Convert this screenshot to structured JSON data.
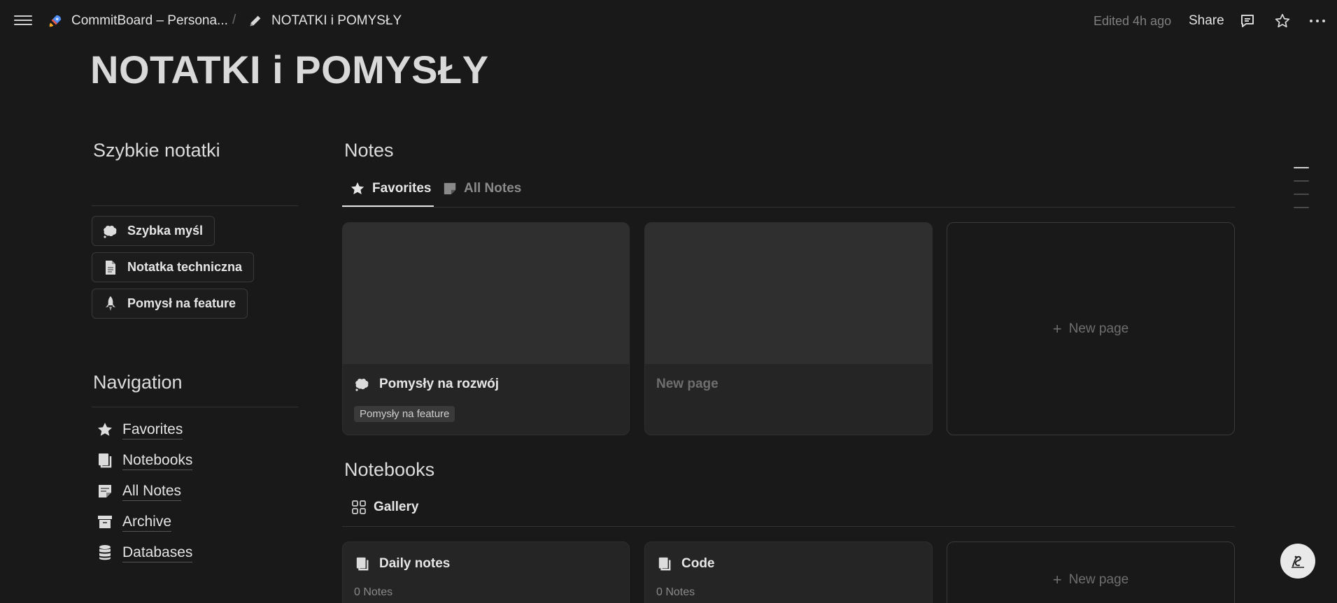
{
  "topbar": {
    "workspace": "CommitBoard – Persona...",
    "separator": "/",
    "page": "NOTATKI i POMYSŁY",
    "edited": "Edited 4h ago",
    "share": "Share",
    "icons": [
      "menu-icon",
      "rocket-icon",
      "pencil-icon",
      "comment-icon",
      "star-icon",
      "more-icon"
    ]
  },
  "page_title": "NOTATKI i POMYSŁY",
  "quick": {
    "title": "Szybkie notatki",
    "buttons": [
      {
        "label": "Szybka myśl",
        "icon": "thought-bubble-icon"
      },
      {
        "label": "Notatka techniczna",
        "icon": "document-icon"
      },
      {
        "label": "Pomysł na feature",
        "icon": "rocket-icon"
      }
    ]
  },
  "navigation": {
    "title": "Navigation",
    "items": [
      {
        "label": "Favorites",
        "icon": "star-icon"
      },
      {
        "label": "Notebooks",
        "icon": "notebook-icon"
      },
      {
        "label": "All Notes",
        "icon": "note-icon"
      },
      {
        "label": "Archive",
        "icon": "archive-icon"
      },
      {
        "label": "Databases",
        "icon": "database-icon"
      }
    ]
  },
  "notes": {
    "title": "Notes",
    "tabs": [
      {
        "label": "Favorites",
        "icon": "star-icon",
        "active": true
      },
      {
        "label": "All Notes",
        "icon": "note-icon",
        "active": false
      }
    ],
    "cards": [
      {
        "title": "Pomysły na rozwój",
        "icon": "thought-bubble-icon",
        "tag": "Pomysły na feature"
      },
      {
        "title": "New page",
        "placeholder": true
      }
    ],
    "new_page": "New page"
  },
  "notebooks": {
    "title": "Notebooks",
    "view": "Gallery",
    "cards": [
      {
        "title": "Daily notes",
        "count": "0 Notes",
        "icon": "notebook-icon"
      },
      {
        "title": "Code",
        "count": "0 Notes",
        "icon": "notebook-icon"
      }
    ],
    "new_page": "New page"
  },
  "colors": {
    "background": "#191919",
    "card": "#252525",
    "cover": "#2f2f2f",
    "text": "#d4d4d4",
    "muted": "#7f7f7f"
  }
}
